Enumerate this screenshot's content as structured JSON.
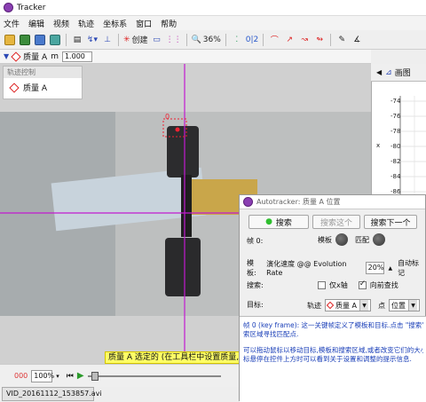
{
  "window": {
    "title": "Tracker"
  },
  "menu": [
    "文件",
    "编辑",
    "视频",
    "轨迹",
    "坐标系",
    "窗口",
    "帮助"
  ],
  "toolbar": {
    "create_label": "创建",
    "zoom_label": "36%",
    "subscript": "0|2"
  },
  "track_bar": {
    "track_name": "质量 A",
    "mass_label": "m",
    "mass_value": "1.000"
  },
  "track_control": {
    "header": "轨迹控制",
    "track_name": "质量 A"
  },
  "video": {
    "point_label": "0",
    "status_text": "质量 A 选定的 (在工具栏中设置质量, 按"
  },
  "plot": {
    "tab_label": "画图",
    "y_axis": "x",
    "ticks": [
      "-74",
      "-76",
      "-78",
      "-80",
      "-82",
      "-84",
      "-86"
    ]
  },
  "bottom": {
    "frame": "000",
    "zoom": "100%",
    "file_tab": "VID_20161112_153857.avi"
  },
  "autotracker": {
    "title": "Autotracker: 质量 A 位置",
    "search_button": "搜索",
    "search_this_button": "搜索这个",
    "search_next_button": "搜索下一个",
    "frame_label": "帧 0:",
    "template_label": "模板",
    "match_label": "匹配",
    "template_row_label": "模板:",
    "evolution_label": "演化速度 @@ Evolution Rate",
    "evolution_value": "20%",
    "auto_mark_label": "自动标记",
    "search_row_label": "搜索:",
    "x_only_label": "仅x轴",
    "look_ahead_label": "向前查找",
    "target_row_label": "目标:",
    "track_label": "轨迹",
    "track_value": "质量 A",
    "point_label": "点",
    "point_value": "位置",
    "info_line1": "帧 0 (key frame): 这一关键帧定义了模板和目标.点击 \"搜索\" 按钮将在",
    "info_line2": "索区域寻找匹配点.",
    "info_line3": "可以拖动鼠标以移动目标,模板和搜索区域,或者改变它们的大小。将",
    "info_line4": "标悬停在控件上方时可以看到关于设置和调整的提示信息."
  }
}
